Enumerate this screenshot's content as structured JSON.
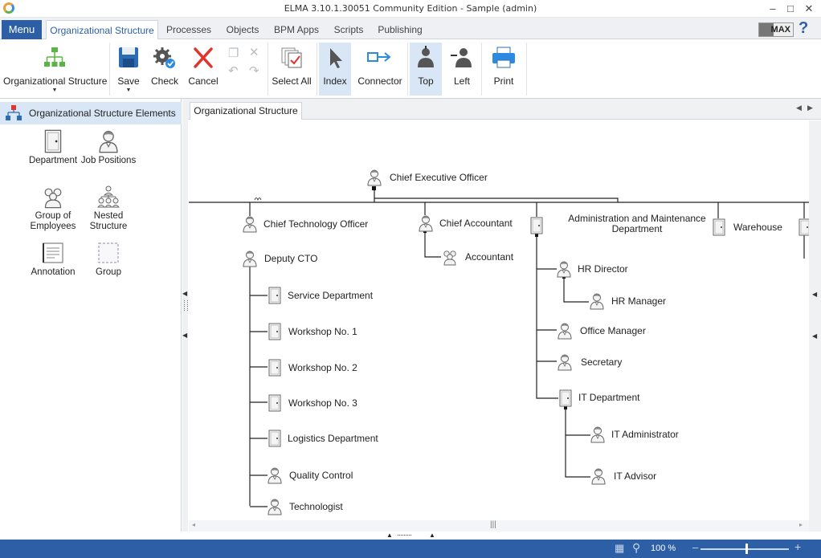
{
  "window": {
    "title": "ELMA 3.10.1.30051 Community Edition - Sample (admin)"
  },
  "tabs": {
    "menu": "Menu",
    "items": [
      "Organizational Structure",
      "Processes",
      "Objects",
      "BPM Apps",
      "Scripts",
      "Publishing"
    ],
    "badge": "MAX",
    "help": "?"
  },
  "ribbon": {
    "org_structure": "Organizational Structure",
    "save": "Save",
    "check": "Check",
    "cancel": "Cancel",
    "select_all": "Select All",
    "index": "Index",
    "connector": "Connector",
    "top": "Top",
    "left": "Left",
    "print": "Print"
  },
  "left_panel": {
    "header": "Organizational Structure Elements",
    "elements": [
      "Department",
      "Job Positions",
      "Group of Employees",
      "Nested Structure",
      "Annotation",
      "Group"
    ]
  },
  "document": {
    "tab": "Organizational Structure"
  },
  "chart": {
    "nodes": {
      "ceo": "Chief Executive Officer",
      "cto": "Chief Technology Officer",
      "deputy_cto": "Deputy CTO",
      "service_dept": "Service Department",
      "workshop1": "Workshop No. 1",
      "workshop2": "Workshop No. 2",
      "workshop3": "Workshop No. 3",
      "logistics": "Logistics Department",
      "quality": "Quality Control",
      "technologist": "Technologist",
      "chief_accountant": "Chief Accountant",
      "accountant": "Accountant",
      "admin_maint": "Administration and Maintenance Department",
      "hr_director": "HR Director",
      "hr_manager": "HR Manager",
      "office_manager": "Office Manager",
      "secretary": "Secretary",
      "it_dept": "IT Department",
      "it_admin": "IT Administrator",
      "it_advisor": "IT Advisor",
      "warehouse": "Warehouse"
    }
  },
  "status": {
    "zoom": "100 %"
  }
}
